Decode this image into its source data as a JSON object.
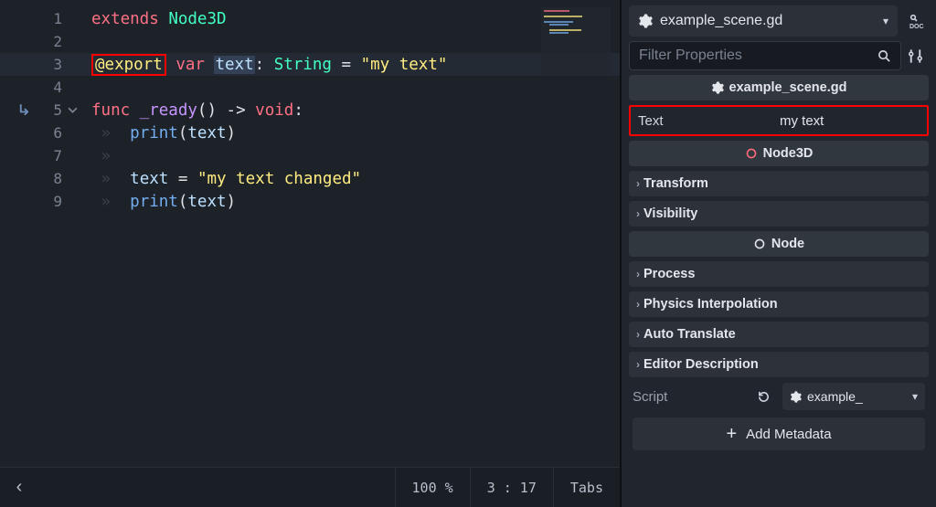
{
  "code": {
    "lines": {
      "1": "1",
      "2": "2",
      "3": "3",
      "4": "4",
      "5": "5",
      "6": "6",
      "7": "7",
      "8": "8",
      "9": "9"
    },
    "l1_extends": "extends",
    "l1_class": "Node3D",
    "l3_export": "@export",
    "l3_var": "var",
    "l3_name": "text",
    "l3_type": "String",
    "l3_val": "\"my text\"",
    "l5_func": "func",
    "l5_name": "_ready",
    "l5_arrow": "->",
    "l5_ret": "void",
    "l6_call": "print",
    "l6_arg": "text",
    "l8_lhs": "text",
    "l8_rhs": "\"my text changed\"",
    "l9_call": "print",
    "l9_arg": "text"
  },
  "status": {
    "zoom": "100 %",
    "pos": "3 :  17",
    "indent": "Tabs"
  },
  "inspector": {
    "file": "example_scene.gd",
    "filter_placeholder": "Filter Properties",
    "script_header": "example_scene.gd",
    "prop_text_label": "Text",
    "prop_text_value": "my text",
    "node3d_header": "Node3D",
    "categories": {
      "transform": "Transform",
      "visibility": "Visibility"
    },
    "node_header": "Node",
    "node_categories": {
      "process": "Process",
      "physics": "Physics Interpolation",
      "autotranslate": "Auto Translate",
      "editordesc": "Editor Description"
    },
    "script_label": "Script",
    "script_value": "example_",
    "add_metadata": "Add Metadata"
  }
}
